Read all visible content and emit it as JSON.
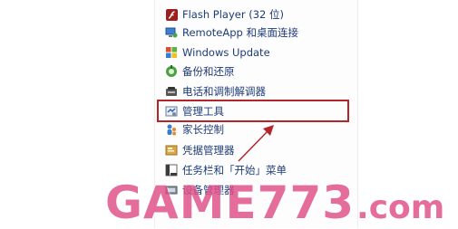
{
  "list": {
    "items": [
      {
        "label": "Flash Player (32 位)",
        "icon": "flash-icon"
      },
      {
        "label": "RemoteApp 和桌面连接",
        "icon": "remote-desktop-icon"
      },
      {
        "label": "Windows Update",
        "icon": "windows-update-icon"
      },
      {
        "label": "备份和还原",
        "icon": "backup-restore-icon"
      },
      {
        "label": "电话和调制解调器",
        "icon": "phone-modem-icon"
      },
      {
        "label": "管理工具",
        "icon": "admin-tools-icon"
      },
      {
        "label": "家长控制",
        "icon": "parental-controls-icon"
      },
      {
        "label": "凭据管理器",
        "icon": "credential-manager-icon"
      },
      {
        "label": "任务栏和「开始」菜单",
        "icon": "taskbar-start-menu-icon"
      },
      {
        "label": "设备管理器",
        "icon": "device-manager-icon"
      }
    ]
  },
  "highlight": {
    "color": "#b4252b"
  },
  "watermark": {
    "main": "GAME773",
    "tld": ".com",
    "color": "#e04e86"
  }
}
